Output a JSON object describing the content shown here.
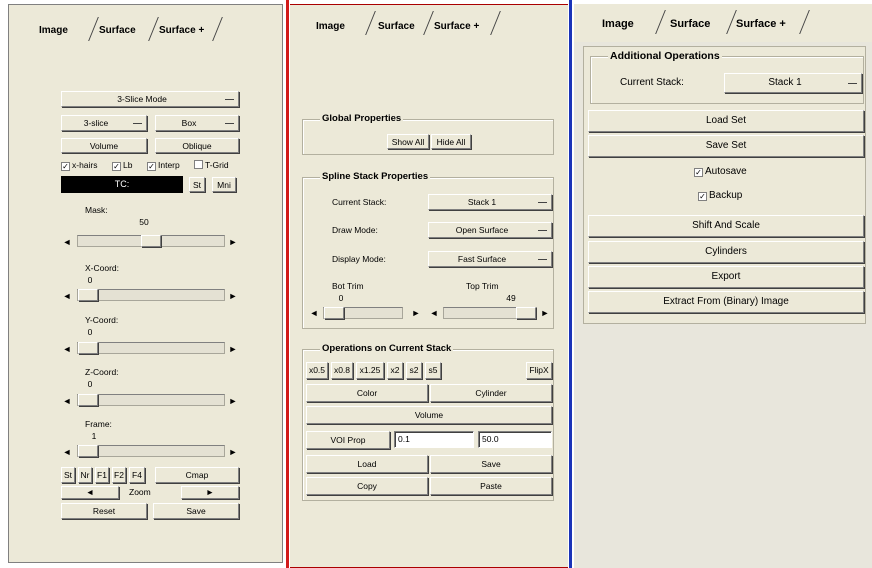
{
  "left_panel": {
    "tabs": [
      "Image",
      "Surface",
      "Surface +"
    ],
    "mode_select": "3-Slice Mode",
    "view_select": "3-slice",
    "shape_select": "Box",
    "volume_button": "Volume",
    "oblique_button": "Oblique",
    "checkboxes": [
      {
        "label": "x-hairs",
        "checked": true
      },
      {
        "label": "Lb",
        "checked": true
      },
      {
        "label": "Interp",
        "checked": true
      },
      {
        "label": "T-Grid",
        "checked": false
      }
    ],
    "tc_label": "TC:",
    "st_button": "St",
    "mni_button": "Mni",
    "mask": {
      "label": "Mask:",
      "value": "50",
      "fraction": 0.5
    },
    "x_coord": {
      "label": "X-Coord:",
      "value": "0",
      "fraction": 0
    },
    "y_coord": {
      "label": "Y-Coord:",
      "value": "0",
      "fraction": 0
    },
    "z_coord": {
      "label": "Z-Coord:",
      "value": "0",
      "fraction": 0
    },
    "frame": {
      "label": "Frame:",
      "value": "1",
      "fraction": 0
    },
    "small_buttons": [
      "St",
      "Nr",
      "F1",
      "F2",
      "F4"
    ],
    "cmap_button": "Cmap",
    "zoom_left": "◄",
    "zoom_label": "Zoom",
    "zoom_right": "►",
    "reset_button": "Reset",
    "save_button": "Save",
    "arrow_left": "◄",
    "arrow_right": "►"
  },
  "middle_panel": {
    "tabs": [
      "Image",
      "Surface",
      "Surface +"
    ],
    "global_properties": {
      "title": "Global Properties",
      "show_all": "Show All",
      "hide_all": "Hide All"
    },
    "spline_stack": {
      "title": "Spline Stack Properties",
      "current_stack_label": "Current Stack:",
      "current_stack_value": "Stack 1",
      "draw_mode_label": "Draw Mode:",
      "draw_mode_value": "Open Surface",
      "display_mode_label": "Display Mode:",
      "display_mode_value": "Fast Surface",
      "bot_trim": {
        "label": "Bot Trim",
        "value": "0",
        "fraction": 0
      },
      "top_trim": {
        "label": "Top Trim",
        "value": "49",
        "fraction": 1
      }
    },
    "operations": {
      "title": "Operations on Current Stack",
      "scale_buttons": [
        "x0.5",
        "x0.8",
        "x1.25",
        "x2",
        "s2",
        "s5"
      ],
      "flipx": "FlipX",
      "color": "Color",
      "cylinder": "Cylinder",
      "volume": "Volume",
      "voi_prop": "VOI Prop",
      "voi_min": "0.1",
      "voi_max": "50.0",
      "load": "Load",
      "save": "Save",
      "copy": "Copy",
      "paste": "Paste"
    }
  },
  "right_panel": {
    "tabs": [
      "Image",
      "Surface",
      "Surface +"
    ],
    "group_title": "Additional Operations",
    "current_stack_label": "Current Stack:",
    "current_stack_value": "Stack 1",
    "load_set": "Load Set",
    "save_set": "Save Set",
    "autosave": {
      "label": "Autosave",
      "checked": true
    },
    "backup": {
      "label": "Backup",
      "checked": true
    },
    "shift_scale": "Shift And Scale",
    "cylinders": "Cylinders",
    "export": "Export",
    "extract": "Extract From (Binary) Image"
  },
  "colors": {
    "panel_bg": "#ece9d8",
    "divider_red": "#d11a1a",
    "divider_blue": "#1a33b8",
    "tc_field": "#000000"
  }
}
